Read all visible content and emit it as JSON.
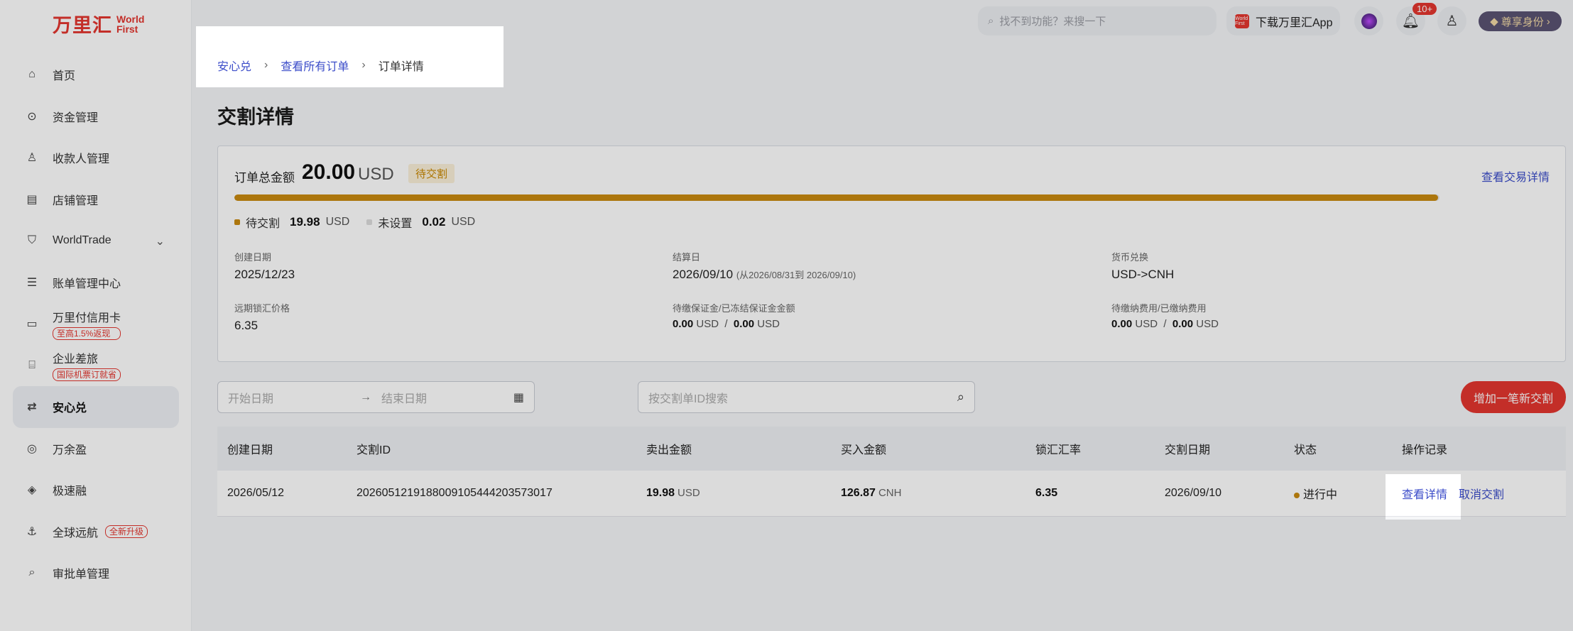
{
  "brand": {
    "logo_cn": "万里汇",
    "logo_en_1": "World",
    "logo_en_2": "First"
  },
  "sidebar": {
    "items": [
      {
        "label": "首页",
        "icon": "home-icon"
      },
      {
        "label": "资金管理",
        "icon": "funds-icon"
      },
      {
        "label": "收款人管理",
        "icon": "user-icon"
      },
      {
        "label": "店铺管理",
        "icon": "store-icon"
      },
      {
        "label": "WorldTrade",
        "icon": "shield-icon"
      },
      {
        "label": "账单管理中心",
        "icon": "bill-icon"
      },
      {
        "label": "万里付信用卡",
        "icon": "card-icon",
        "tag": "至高1.5%返现"
      },
      {
        "label": "企业差旅",
        "icon": "luggage-icon",
        "tag": "国际机票订就省"
      },
      {
        "label": "安心兑",
        "icon": "exchange-icon"
      },
      {
        "label": "万余盈",
        "icon": "coin-icon"
      },
      {
        "label": "极速融",
        "icon": "finance-icon"
      },
      {
        "label": "全球远航",
        "icon": "globe-icon",
        "tag": "全新升级"
      },
      {
        "label": "审批单管理",
        "icon": "approval-icon"
      }
    ]
  },
  "header": {
    "search_placeholder": "找不到功能？来搜一下",
    "app_download": "下载万里汇App",
    "app_icon_text": "World First",
    "notif_badge": "10+",
    "vip_label": "尊享身份"
  },
  "breadcrumb": {
    "b1": "安心兑",
    "b2": "查看所有订单",
    "b3": "订单详情",
    "sep": "›"
  },
  "page_title": "交割详情",
  "summary": {
    "total_label": "订单总金额",
    "total_value": "20.00",
    "total_currency": "USD",
    "status": "待交割",
    "view_trade": "查看交易详情",
    "progress_fraction": 0.999,
    "legend": [
      {
        "label": "待交割",
        "value": "19.98",
        "unit": "USD",
        "color": "#c98a10"
      },
      {
        "label": "未设置",
        "value": "0.02",
        "unit": "USD",
        "color": "#dddddd"
      }
    ],
    "fields": {
      "created_label": "创建日期",
      "created_value": "2025/12/23",
      "settle_label": "结算日",
      "settle_value": "2026/09/10",
      "settle_range": "(从2026/08/31到 2026/09/10)",
      "fx_label": "货币兑换",
      "fx_value": "USD->CNH",
      "fwd_label": "远期锁汇价格",
      "fwd_value": "6.35",
      "margin_label": "待缴保证金/已冻结保证金金额",
      "margin_v1": "0.00",
      "margin_v2": "0.00",
      "fee_label": "待缴纳费用/已缴纳费用",
      "fee_v1": "0.00",
      "fee_v2": "0.00",
      "unit": "USD",
      "slash": "/"
    }
  },
  "filters": {
    "start_placeholder": "开始日期",
    "end_placeholder": "结束日期",
    "search_placeholder": "按交割单ID搜索",
    "add_button": "增加一笔新交割"
  },
  "table": {
    "headers": [
      "创建日期",
      "交割ID",
      "卖出金额",
      "买入金额",
      "锁汇汇率",
      "交割日期",
      "状态",
      "操作记录"
    ],
    "rows": [
      {
        "created": "2026/05/12",
        "id": "2026051219188009105444203573017",
        "sell": "19.98",
        "sell_cur": "USD",
        "buy": "126.87",
        "buy_cur": "CNH",
        "rate": "6.35",
        "delivery": "2026/09/10",
        "status": "进行中",
        "op_view": "查看详情",
        "op_cancel": "取消交割"
      }
    ]
  }
}
